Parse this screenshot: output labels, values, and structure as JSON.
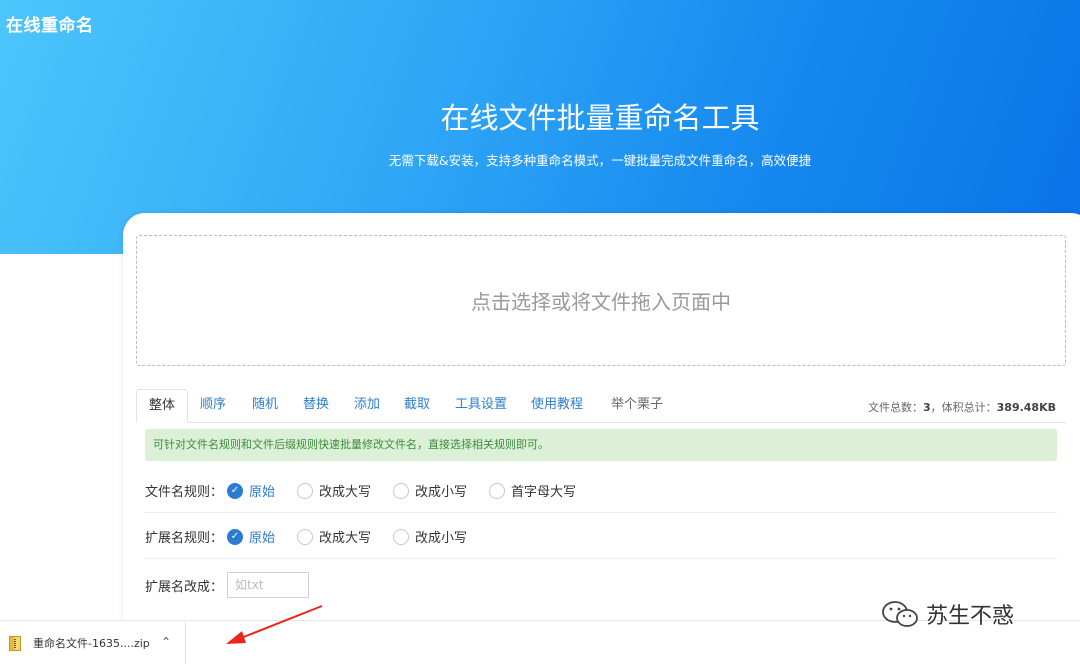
{
  "header": {
    "brand": "在线重命名",
    "title": "在线文件批量重命名工具",
    "subtitle": "无需下载&安装，支持多种重命名模式，一键批量完成文件重命名，高效便捷"
  },
  "dropzone": {
    "label": "点击选择或将文件拖入页面中"
  },
  "tabs": [
    {
      "label": "整体",
      "active": true
    },
    {
      "label": "顺序"
    },
    {
      "label": "随机"
    },
    {
      "label": "替换"
    },
    {
      "label": "添加"
    },
    {
      "label": "截取"
    },
    {
      "label": "工具设置"
    },
    {
      "label": "使用教程"
    },
    {
      "label": "举个栗子"
    }
  ],
  "stats": {
    "count_label": "文件总数：",
    "count": "3",
    "size_label": "，体积总计：",
    "size": "389.48KB"
  },
  "tip": "可针对文件名规则和文件后缀规则快速批量修改文件名，直接选择相关规则即可。",
  "filename_rule": {
    "label": "文件名规则：",
    "options": [
      "原始",
      "改成大写",
      "改成小写",
      "首字母大写"
    ],
    "selected": "原始"
  },
  "ext_rule": {
    "label": "扩展名规则：",
    "options": [
      "原始",
      "改成大写",
      "改成小写"
    ],
    "selected": "原始"
  },
  "ext_change": {
    "label": "扩展名改成：",
    "placeholder": "如txt"
  },
  "download": {
    "filename": "重命名文件-1635....zip"
  },
  "watermark": {
    "text": "苏生不惑"
  },
  "colors": {
    "accent": "#2b7bd4",
    "hero_start": "#4cc6fb",
    "hero_end": "#0a73e8",
    "tip_bg": "#dbf0d7",
    "annotation_arrow": "#e8281e"
  }
}
